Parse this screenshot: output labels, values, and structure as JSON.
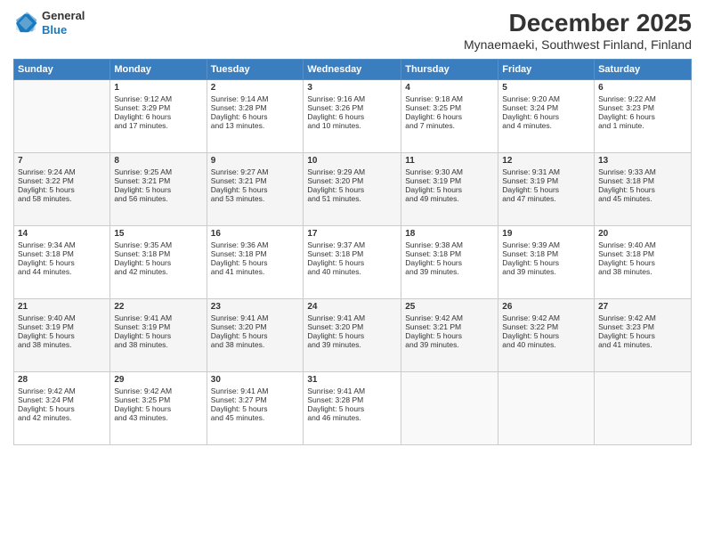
{
  "logo": {
    "general": "General",
    "blue": "Blue"
  },
  "title": "December 2025",
  "subtitle": "Mynaemaeki, Southwest Finland, Finland",
  "days": [
    "Sunday",
    "Monday",
    "Tuesday",
    "Wednesday",
    "Thursday",
    "Friday",
    "Saturday"
  ],
  "weeks": [
    [
      {
        "day": "",
        "content": ""
      },
      {
        "day": "1",
        "content": "Sunrise: 9:12 AM\nSunset: 3:29 PM\nDaylight: 6 hours\nand 17 minutes."
      },
      {
        "day": "2",
        "content": "Sunrise: 9:14 AM\nSunset: 3:28 PM\nDaylight: 6 hours\nand 13 minutes."
      },
      {
        "day": "3",
        "content": "Sunrise: 9:16 AM\nSunset: 3:26 PM\nDaylight: 6 hours\nand 10 minutes."
      },
      {
        "day": "4",
        "content": "Sunrise: 9:18 AM\nSunset: 3:25 PM\nDaylight: 6 hours\nand 7 minutes."
      },
      {
        "day": "5",
        "content": "Sunrise: 9:20 AM\nSunset: 3:24 PM\nDaylight: 6 hours\nand 4 minutes."
      },
      {
        "day": "6",
        "content": "Sunrise: 9:22 AM\nSunset: 3:23 PM\nDaylight: 6 hours\nand 1 minute."
      }
    ],
    [
      {
        "day": "7",
        "content": "Sunrise: 9:24 AM\nSunset: 3:22 PM\nDaylight: 5 hours\nand 58 minutes."
      },
      {
        "day": "8",
        "content": "Sunrise: 9:25 AM\nSunset: 3:21 PM\nDaylight: 5 hours\nand 56 minutes."
      },
      {
        "day": "9",
        "content": "Sunrise: 9:27 AM\nSunset: 3:21 PM\nDaylight: 5 hours\nand 53 minutes."
      },
      {
        "day": "10",
        "content": "Sunrise: 9:29 AM\nSunset: 3:20 PM\nDaylight: 5 hours\nand 51 minutes."
      },
      {
        "day": "11",
        "content": "Sunrise: 9:30 AM\nSunset: 3:19 PM\nDaylight: 5 hours\nand 49 minutes."
      },
      {
        "day": "12",
        "content": "Sunrise: 9:31 AM\nSunset: 3:19 PM\nDaylight: 5 hours\nand 47 minutes."
      },
      {
        "day": "13",
        "content": "Sunrise: 9:33 AM\nSunset: 3:18 PM\nDaylight: 5 hours\nand 45 minutes."
      }
    ],
    [
      {
        "day": "14",
        "content": "Sunrise: 9:34 AM\nSunset: 3:18 PM\nDaylight: 5 hours\nand 44 minutes."
      },
      {
        "day": "15",
        "content": "Sunrise: 9:35 AM\nSunset: 3:18 PM\nDaylight: 5 hours\nand 42 minutes."
      },
      {
        "day": "16",
        "content": "Sunrise: 9:36 AM\nSunset: 3:18 PM\nDaylight: 5 hours\nand 41 minutes."
      },
      {
        "day": "17",
        "content": "Sunrise: 9:37 AM\nSunset: 3:18 PM\nDaylight: 5 hours\nand 40 minutes."
      },
      {
        "day": "18",
        "content": "Sunrise: 9:38 AM\nSunset: 3:18 PM\nDaylight: 5 hours\nand 39 minutes."
      },
      {
        "day": "19",
        "content": "Sunrise: 9:39 AM\nSunset: 3:18 PM\nDaylight: 5 hours\nand 39 minutes."
      },
      {
        "day": "20",
        "content": "Sunrise: 9:40 AM\nSunset: 3:18 PM\nDaylight: 5 hours\nand 38 minutes."
      }
    ],
    [
      {
        "day": "21",
        "content": "Sunrise: 9:40 AM\nSunset: 3:19 PM\nDaylight: 5 hours\nand 38 minutes."
      },
      {
        "day": "22",
        "content": "Sunrise: 9:41 AM\nSunset: 3:19 PM\nDaylight: 5 hours\nand 38 minutes."
      },
      {
        "day": "23",
        "content": "Sunrise: 9:41 AM\nSunset: 3:20 PM\nDaylight: 5 hours\nand 38 minutes."
      },
      {
        "day": "24",
        "content": "Sunrise: 9:41 AM\nSunset: 3:20 PM\nDaylight: 5 hours\nand 39 minutes."
      },
      {
        "day": "25",
        "content": "Sunrise: 9:42 AM\nSunset: 3:21 PM\nDaylight: 5 hours\nand 39 minutes."
      },
      {
        "day": "26",
        "content": "Sunrise: 9:42 AM\nSunset: 3:22 PM\nDaylight: 5 hours\nand 40 minutes."
      },
      {
        "day": "27",
        "content": "Sunrise: 9:42 AM\nSunset: 3:23 PM\nDaylight: 5 hours\nand 41 minutes."
      }
    ],
    [
      {
        "day": "28",
        "content": "Sunrise: 9:42 AM\nSunset: 3:24 PM\nDaylight: 5 hours\nand 42 minutes."
      },
      {
        "day": "29",
        "content": "Sunrise: 9:42 AM\nSunset: 3:25 PM\nDaylight: 5 hours\nand 43 minutes."
      },
      {
        "day": "30",
        "content": "Sunrise: 9:41 AM\nSunset: 3:27 PM\nDaylight: 5 hours\nand 45 minutes."
      },
      {
        "day": "31",
        "content": "Sunrise: 9:41 AM\nSunset: 3:28 PM\nDaylight: 5 hours\nand 46 minutes."
      },
      {
        "day": "",
        "content": ""
      },
      {
        "day": "",
        "content": ""
      },
      {
        "day": "",
        "content": ""
      }
    ]
  ]
}
